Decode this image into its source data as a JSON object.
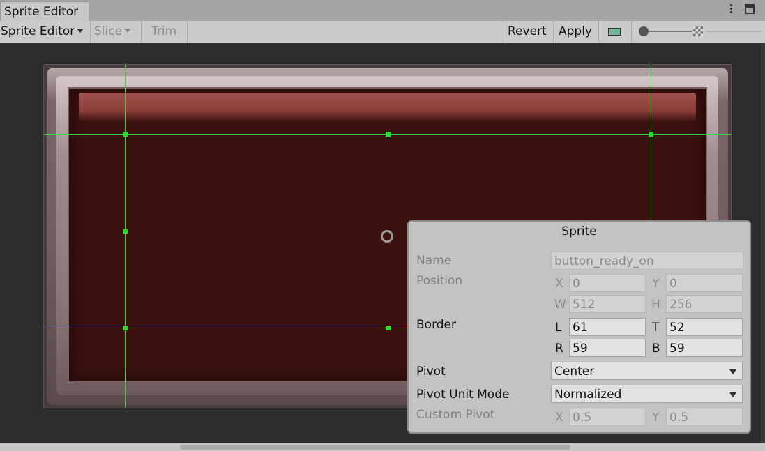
{
  "window": {
    "tab_title": "Sprite Editor",
    "menu_icon": "kebab-menu-icon",
    "maximize_icon": "maximize-icon"
  },
  "toolbar": {
    "mode_label": "Sprite Editor",
    "slice_label": "Slice",
    "trim_label": "Trim",
    "revert_label": "Revert",
    "apply_label": "Apply",
    "color_mode_icon": "preview-toggle-icon",
    "alpha_icon": "checkerboard-icon"
  },
  "sprite_panel": {
    "title": "Sprite",
    "name_label": "Name",
    "name_value": "button_ready_on",
    "position_label": "Position",
    "position": {
      "x_label": "X",
      "x": "0",
      "y_label": "Y",
      "y": "0",
      "w_label": "W",
      "w": "512",
      "h_label": "H",
      "h": "256"
    },
    "border_label": "Border",
    "border": {
      "l_label": "L",
      "l": "61",
      "t_label": "T",
      "t": "52",
      "r_label": "R",
      "r": "59",
      "b_label": "B",
      "b": "59"
    },
    "pivot_label": "Pivot",
    "pivot_value": "Center",
    "pivot_unit_label": "Pivot Unit Mode",
    "pivot_unit_value": "Normalized",
    "custom_pivot_label": "Custom Pivot",
    "custom_pivot": {
      "x_label": "X",
      "x": "0.5",
      "y_label": "Y",
      "y": "0.5"
    }
  },
  "colors": {
    "guide": "#2fdc2f",
    "canvas": "#2c2c2c",
    "sprite_fill": "#3b1210"
  }
}
